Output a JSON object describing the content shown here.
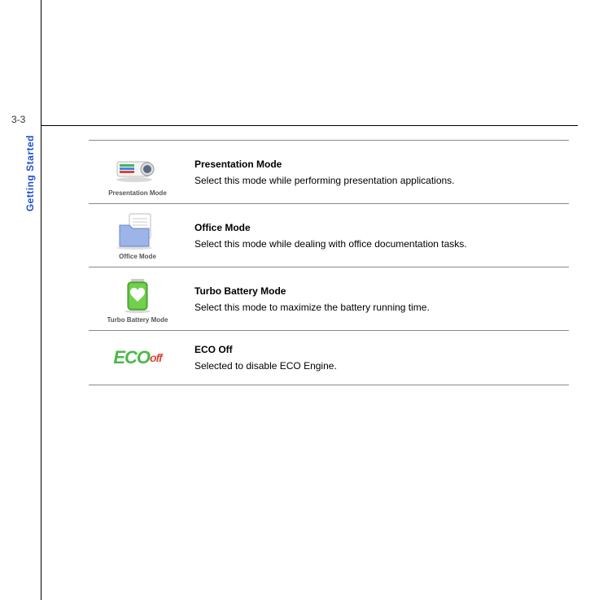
{
  "page_number": "3-3",
  "side_label": "Getting Started",
  "modes": [
    {
      "caption": "Presentation Mode",
      "title": "Presentation Mode",
      "desc": "Select this mode while performing presentation applications."
    },
    {
      "caption": "Office Mode",
      "title": "Office Mode",
      "desc": "Select this mode while dealing with office documentation tasks."
    },
    {
      "caption": "Turbo Battery Mode",
      "title": "Turbo Battery Mode",
      "desc": "Select this mode to maximize the battery running time."
    },
    {
      "caption": "",
      "title": "ECO Off",
      "desc": "Selected to disable ECO Engine."
    }
  ],
  "eco": {
    "main": "ECO",
    "sub": "off"
  }
}
